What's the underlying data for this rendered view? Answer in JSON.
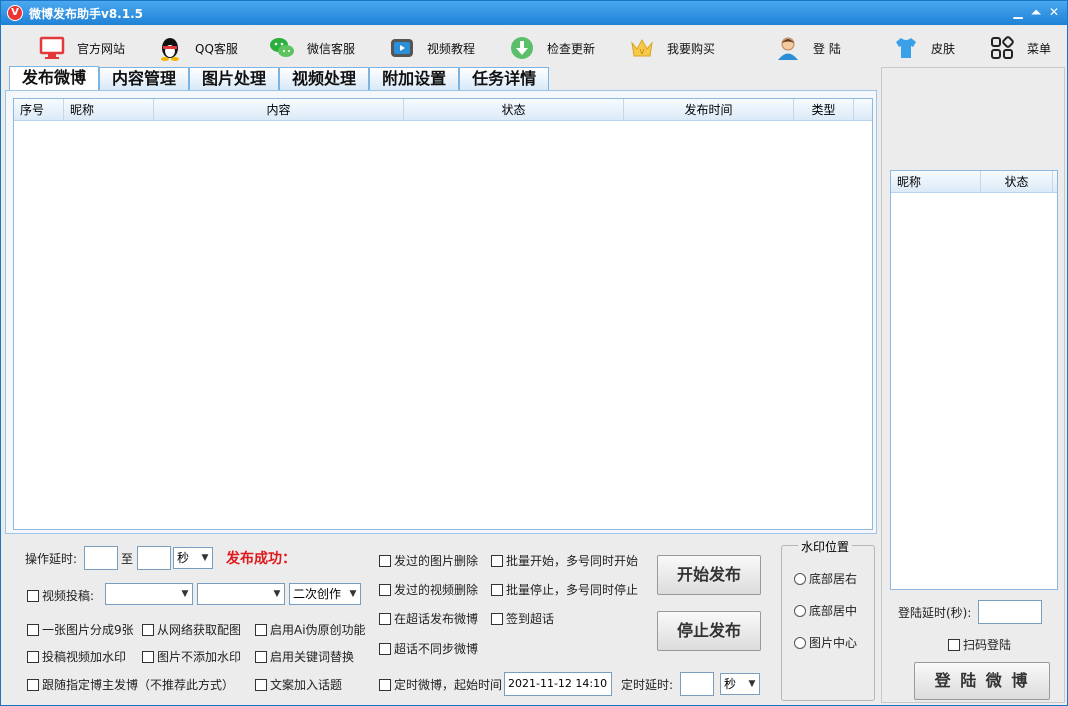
{
  "window": {
    "title": "微博发布助手v8.1.5",
    "icon_letter": "V",
    "controls": [
      "▁",
      "⏶",
      "✕"
    ]
  },
  "toolbar": [
    {
      "label": "官方网站",
      "icon": "monitor-icon"
    },
    {
      "label": "QQ客服",
      "icon": "qq-penguin-icon"
    },
    {
      "label": "微信客服",
      "icon": "wechat-icon"
    },
    {
      "label": "视频教程",
      "icon": "video-icon"
    },
    {
      "label": "检查更新",
      "icon": "download-icon"
    },
    {
      "label": "我要购买",
      "icon": "crown-icon"
    },
    {
      "label": "登 陆",
      "icon": "user-icon"
    },
    {
      "label": "皮肤",
      "icon": "shirt-icon"
    },
    {
      "label": "菜单",
      "icon": "grid-menu-icon"
    }
  ],
  "tabs": [
    "发布微博",
    "内容管理",
    "图片处理",
    "视频处理",
    "附加设置",
    "任务详情"
  ],
  "main_table": {
    "columns": [
      "序号",
      "昵称",
      "内容",
      "状态",
      "发布时间",
      "类型"
    ]
  },
  "controls": {
    "op_delay_label": "操作延时:",
    "to_label": "至",
    "sec_unit": "秒",
    "publish_status": "发布成功：",
    "video_submit_label": "视频投稿:",
    "second_creation": "二次创作",
    "split_nine": "一张图片分成9张",
    "fetch_network_image": "从网络获取配图",
    "enable_ai": "启用Ai伪原创功能",
    "video_watermark": "投稿视频加水印",
    "no_watermark": "图片不添加水印",
    "keyword_replace": "启用关键词替换",
    "follow_blogger": "跟随指定博主发博（不推荐此方式）",
    "add_topic": "文案加入话题",
    "delete_sent_images": "发过的图片删除",
    "delete_sent_videos": "发过的视频删除",
    "post_in_super_topic": "在超话发布微博",
    "super_topic_no_sync": "超话不同步微博",
    "batch_start": "批量开始，多号同时开始",
    "batch_stop": "批量停止，多号同时停止",
    "checkin_super_topic": "签到超话",
    "timed_post": "定时微博，起始时间：",
    "start_time": "2021-11-12 14:10",
    "timed_delay_label": "定时延时:",
    "timed_unit": "秒",
    "start_button": "开始发布",
    "stop_button": "停止发布"
  },
  "watermark": {
    "title": "水印位置",
    "options": [
      "底部居右",
      "底部居中",
      "图片中心"
    ]
  },
  "right": {
    "columns": [
      "昵称",
      "状态"
    ],
    "login_delay_label": "登陆延时(秒):",
    "scan_login": "扫码登陆",
    "login_button": "登 陆 微 博"
  }
}
